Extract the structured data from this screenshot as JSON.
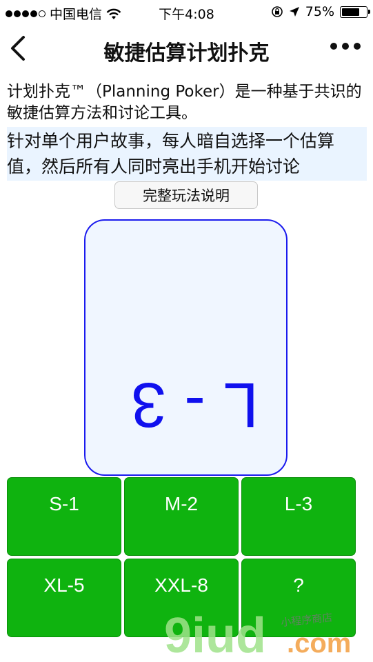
{
  "status_bar": {
    "carrier": "中国电信",
    "time": "下午4:08",
    "battery": "75%",
    "battery_level": 0.75
  },
  "nav": {
    "title": "敏捷估算计划扑克"
  },
  "intro": {
    "description": "计划扑克™（Planning Poker）是一种基于共识的敏捷估算方法和讨论工具。",
    "instruction": "针对单个用户故事，每人暗自选择一个估算值，然后所有人同时亮出手机开始讨论",
    "rules_button": "完整玩法说明"
  },
  "card": {
    "value": "L-3"
  },
  "estimates": [
    "S-1",
    "M-2",
    "L-3",
    "XL-5",
    "XXL-8",
    "?"
  ],
  "watermark": {
    "logo_text": "9iud.com",
    "tagline": "小程序商店"
  },
  "colors": {
    "button_green": "#0fb30f",
    "card_blue": "#1010ee",
    "highlight_bg": "#eaf4ff"
  }
}
